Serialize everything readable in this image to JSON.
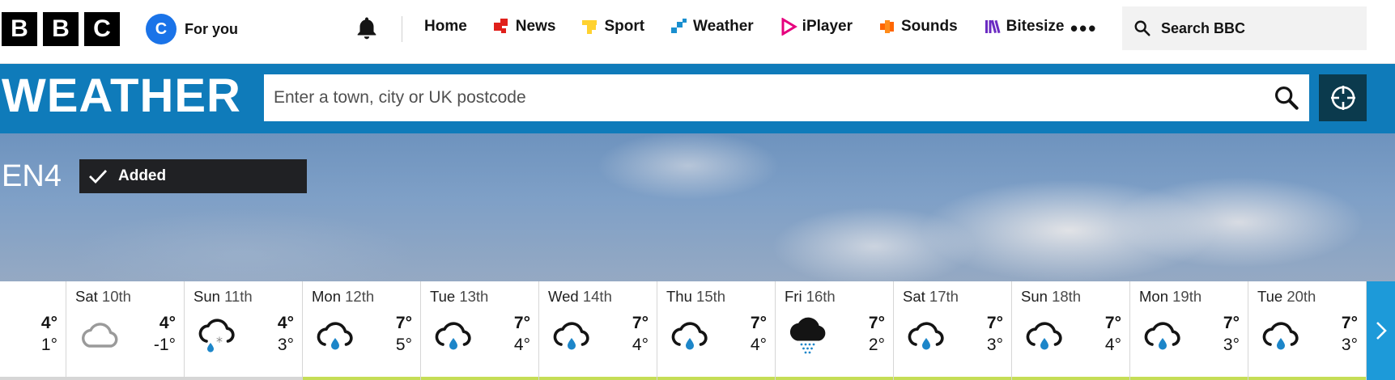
{
  "nav": {
    "logo_letters": [
      "B",
      "B",
      "C"
    ],
    "avatar_initial": "C",
    "for_you": "For you",
    "links": [
      {
        "label": "Home",
        "icon": "none",
        "color": ""
      },
      {
        "label": "News",
        "icon": "news-icon",
        "color": "#e0201b"
      },
      {
        "label": "Sport",
        "icon": "sport-icon",
        "color": "#ffd230"
      },
      {
        "label": "Weather",
        "icon": "weather-icon",
        "color": "#1a8fcf"
      },
      {
        "label": "iPlayer",
        "icon": "iplayer-icon",
        "color": "#e6007e"
      },
      {
        "label": "Sounds",
        "icon": "sounds-icon",
        "color": "#ff6600"
      },
      {
        "label": "Bitesize",
        "icon": "bitesize-icon",
        "color": "#6b2bc2"
      }
    ],
    "more": "•••",
    "search_label": "Search BBC"
  },
  "weather": {
    "title": "WEATHER",
    "search_placeholder": "Enter a town, city or UK postcode"
  },
  "location": {
    "postcode": "EN4",
    "added_label": "Added"
  },
  "forecast": [
    {
      "day": "",
      "date": "",
      "hi": "4°",
      "lo": "1°",
      "icon": "partial-icon",
      "bar": "gray"
    },
    {
      "day": "Sat",
      "date": "10th",
      "hi": "4°",
      "lo": "-1°",
      "icon": "cloud-icon",
      "bar": "gray"
    },
    {
      "day": "Sun",
      "date": "11th",
      "hi": "4°",
      "lo": "3°",
      "icon": "sleet-icon",
      "bar": "gray"
    },
    {
      "day": "Mon",
      "date": "12th",
      "hi": "7°",
      "lo": "5°",
      "icon": "light-rain-icon",
      "bar": "green"
    },
    {
      "day": "Tue",
      "date": "13th",
      "hi": "7°",
      "lo": "4°",
      "icon": "light-rain-icon",
      "bar": "green"
    },
    {
      "day": "Wed",
      "date": "14th",
      "hi": "7°",
      "lo": "4°",
      "icon": "light-rain-icon",
      "bar": "green"
    },
    {
      "day": "Thu",
      "date": "15th",
      "hi": "7°",
      "lo": "4°",
      "icon": "light-rain-icon",
      "bar": "green"
    },
    {
      "day": "Fri",
      "date": "16th",
      "hi": "7°",
      "lo": "2°",
      "icon": "drizzle-icon",
      "bar": "green"
    },
    {
      "day": "Sat",
      "date": "17th",
      "hi": "7°",
      "lo": "3°",
      "icon": "light-rain-icon",
      "bar": "green"
    },
    {
      "day": "Sun",
      "date": "18th",
      "hi": "7°",
      "lo": "4°",
      "icon": "light-rain-icon",
      "bar": "green"
    },
    {
      "day": "Mon",
      "date": "19th",
      "hi": "7°",
      "lo": "3°",
      "icon": "light-rain-icon",
      "bar": "green"
    },
    {
      "day": "Tue",
      "date": "20th",
      "hi": "7°",
      "lo": "3°",
      "icon": "light-rain-icon",
      "bar": "green"
    }
  ],
  "colors": {
    "weather_blue": "#0f7bba",
    "locate_dark": "#0b3a4d",
    "next_blue": "#1d9ad9",
    "bar_green": "#c5dd56"
  }
}
